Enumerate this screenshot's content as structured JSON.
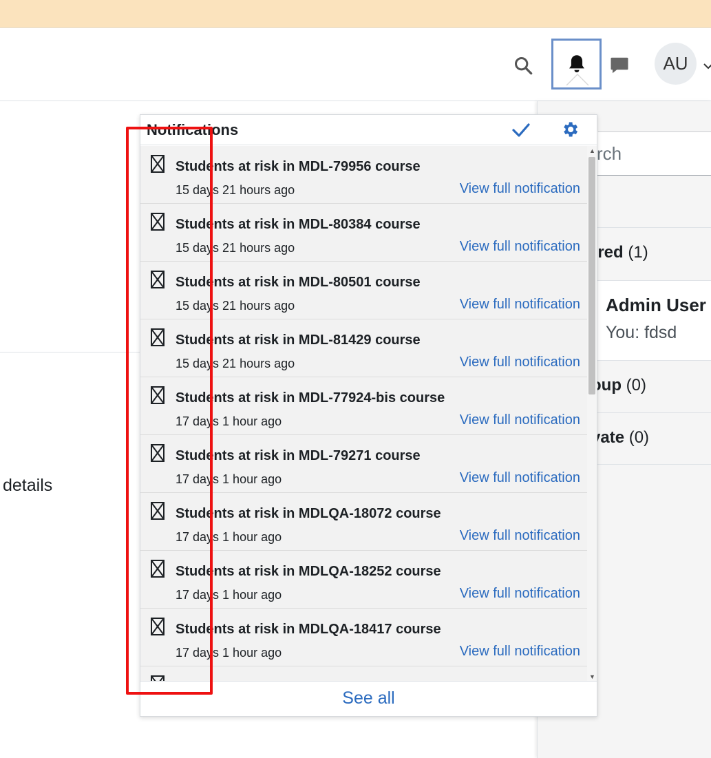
{
  "navbar": {
    "avatar_initials": "AU",
    "icons": {
      "search": "search-icon",
      "notifications": "bell-icon",
      "messages": "chat-bubble-icon",
      "avatar_menu": "chevron-down-icon"
    }
  },
  "main": {
    "details_text": "details"
  },
  "drawer": {
    "search_placeholder": "rch",
    "sections": [
      {
        "label": "rred",
        "count": "(1)"
      },
      {
        "label": "oup",
        "count": "(0)"
      },
      {
        "label": "vate",
        "count": "(0)"
      }
    ],
    "conversation": {
      "name": "Admin User",
      "last_message": "You: fdsd"
    }
  },
  "popover": {
    "title": "Notifications",
    "icons": {
      "mark_all_read": "checkmark-icon",
      "settings": "gear-icon"
    },
    "see_all": "See all",
    "notifications": [
      {
        "title": "Students at risk in MDL-79956 course",
        "time": "15 days 21 hours ago",
        "link": "View full notification"
      },
      {
        "title": "Students at risk in MDL-80384 course",
        "time": "15 days 21 hours ago",
        "link": "View full notification"
      },
      {
        "title": "Students at risk in MDL-80501 course",
        "time": "15 days 21 hours ago",
        "link": "View full notification"
      },
      {
        "title": "Students at risk in MDL-81429 course",
        "time": "15 days 21 hours ago",
        "link": "View full notification"
      },
      {
        "title": "Students at risk in MDL-77924-bis course",
        "time": "17 days 1 hour ago",
        "link": "View full notification"
      },
      {
        "title": "Students at risk in MDL-79271 course",
        "time": "17 days 1 hour ago",
        "link": "View full notification"
      },
      {
        "title": "Students at risk in MDLQA-18072 course",
        "time": "17 days 1 hour ago",
        "link": "View full notification"
      },
      {
        "title": "Students at risk in MDLQA-18252 course",
        "time": "17 days 1 hour ago",
        "link": "View full notification"
      },
      {
        "title": "Students at risk in MDLQA-18417 course",
        "time": "17 days 1 hour ago",
        "link": "View full notification"
      }
    ]
  },
  "colors": {
    "accent": "#2b6bbf",
    "highlight": "#ee1111",
    "banner": "#fbe3bd"
  }
}
